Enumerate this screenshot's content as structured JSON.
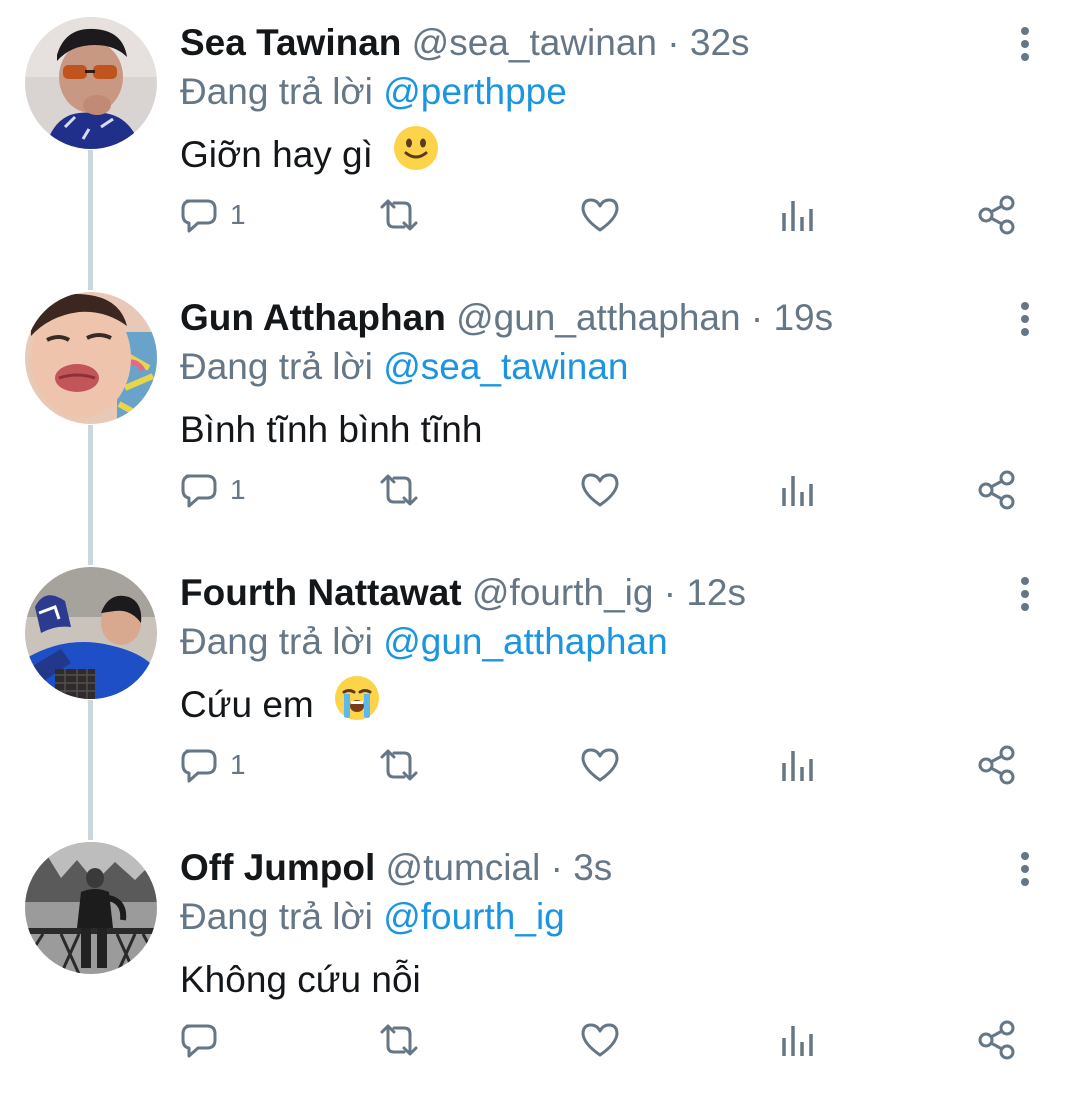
{
  "colors": {
    "name_text": "#14171a",
    "secondary_text": "#657786",
    "mention_link": "#1b95e0",
    "thread_line": "#ccd6dd",
    "icon_gray": "#657786"
  },
  "tweets": [
    {
      "name": "Sea Tawinan",
      "handle": "@sea_tawinan",
      "separator": "·",
      "time": "32s",
      "reply_prefix": "Đang trả lời",
      "reply_to": "@perthppe",
      "text": "Giỡn hay gì",
      "emoji": "slightly-smiling-face",
      "reply_count": "1",
      "icons": [
        "reply-icon",
        "retweet-icon",
        "like-icon",
        "analytics-icon",
        "share-icon",
        "more-options-icon"
      ]
    },
    {
      "name": "Gun Atthaphan",
      "handle": "@gun_atthaphan",
      "separator": "·",
      "time": "19s",
      "reply_prefix": "Đang trả lời",
      "reply_to": "@sea_tawinan",
      "text": "Bình tĩnh bình tĩnh",
      "emoji": "",
      "reply_count": "1",
      "icons": [
        "reply-icon",
        "retweet-icon",
        "like-icon",
        "analytics-icon",
        "share-icon",
        "more-options-icon"
      ]
    },
    {
      "name": "Fourth Nattawat",
      "handle": "@fourth_ig",
      "separator": "·",
      "time": "12s",
      "reply_prefix": "Đang trả lời",
      "reply_to": "@gun_atthaphan",
      "text": "Cứu em",
      "emoji": "loudly-crying-face",
      "reply_count": "1",
      "icons": [
        "reply-icon",
        "retweet-icon",
        "like-icon",
        "analytics-icon",
        "share-icon",
        "more-options-icon"
      ]
    },
    {
      "name": "Off Jumpol",
      "handle": "@tumcial",
      "separator": "·",
      "time": "3s",
      "reply_prefix": "Đang trả lời",
      "reply_to": "@fourth_ig",
      "text": "Không cứu nỗi",
      "emoji": "",
      "reply_count": "",
      "icons": [
        "reply-icon",
        "retweet-icon",
        "like-icon",
        "analytics-icon",
        "share-icon",
        "more-options-icon"
      ]
    }
  ]
}
